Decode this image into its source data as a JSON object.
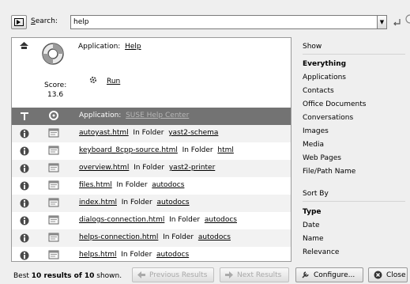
{
  "search": {
    "label_prefix": "S",
    "label_rest": "earch:",
    "value": "help"
  },
  "top_result": {
    "type_label": "Application:",
    "name": "Help",
    "score_label": "Score:",
    "score_value": "13.6",
    "action": "Run"
  },
  "rows": [
    {
      "kind": "app",
      "label": "Application:",
      "name": "SUSE Help Center",
      "selected": true
    },
    {
      "kind": "file",
      "name": "autoyast.html",
      "in": "In Folder",
      "folder": "yast2-schema"
    },
    {
      "kind": "file",
      "name": "keyboard_8cpp-source.html",
      "in": "In Folder",
      "folder": "html"
    },
    {
      "kind": "file",
      "name": "overview.html",
      "in": "In Folder",
      "folder": "yast2-printer"
    },
    {
      "kind": "file",
      "name": "files.html",
      "in": "In Folder",
      "folder": "autodocs"
    },
    {
      "kind": "file",
      "name": "index.html",
      "in": "In Folder",
      "folder": "autodocs"
    },
    {
      "kind": "file",
      "name": "dialogs-connection.html",
      "in": "In Folder",
      "folder": "autodocs"
    },
    {
      "kind": "file",
      "name": "helps-connection.html",
      "in": "In Folder",
      "folder": "autodocs"
    },
    {
      "kind": "file",
      "name": "helps.html",
      "in": "In Folder",
      "folder": "autodocs"
    }
  ],
  "side": {
    "show_header": "Show",
    "show_items": [
      "Everything",
      "Applications",
      "Contacts",
      "Office Documents",
      "Conversations",
      "Images",
      "Media",
      "Web Pages",
      "File/Path Name"
    ],
    "show_selected": "Everything",
    "sort_header": "Sort By",
    "sort_items": [
      "Type",
      "Date",
      "Name",
      "Relevance"
    ],
    "sort_selected": "Type"
  },
  "status": {
    "prefix": "Best ",
    "bold": "10 results of 10",
    "suffix": " shown."
  },
  "buttons": {
    "previous": "Previous Results",
    "next": "Next Results",
    "configure": "Configure...",
    "close": "Close"
  }
}
